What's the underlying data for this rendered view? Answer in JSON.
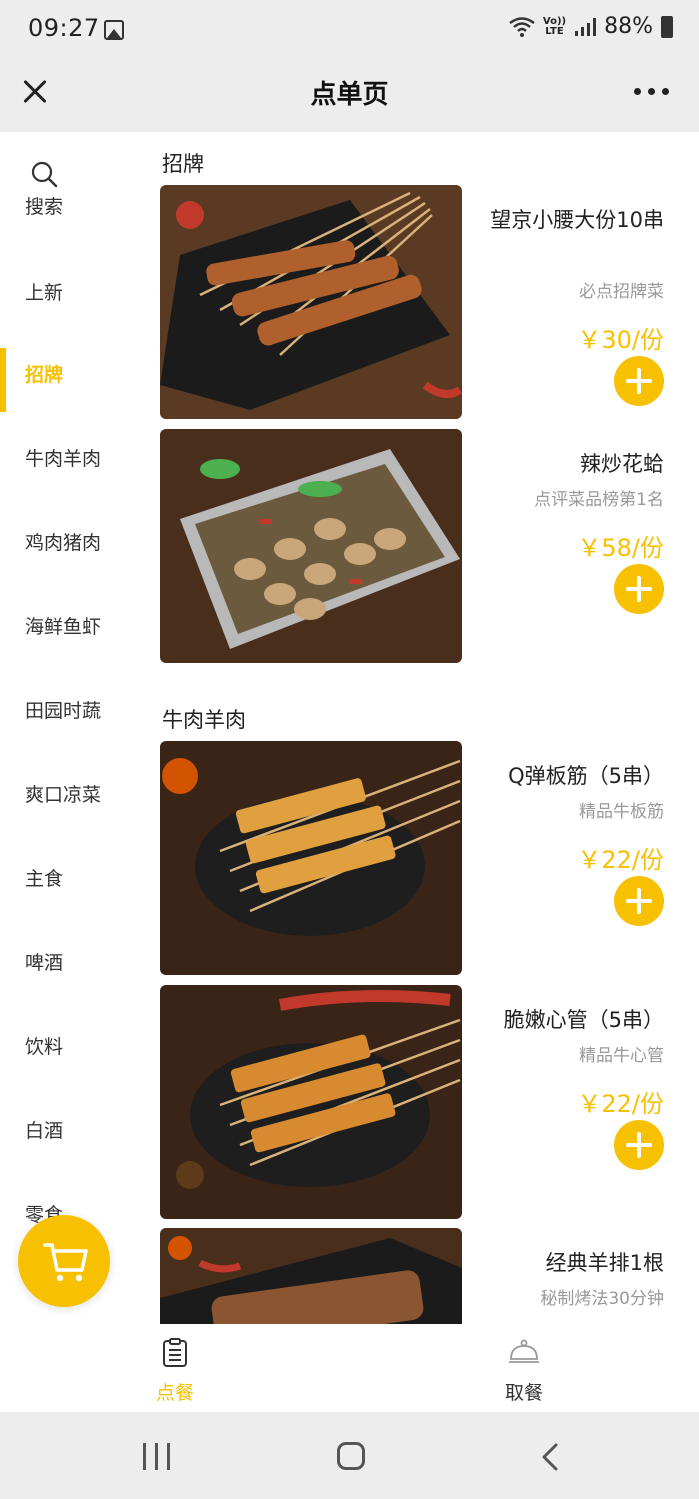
{
  "status_bar": {
    "time": "09:27",
    "battery": "88%",
    "volte": "Vo)) LTE"
  },
  "header": {
    "title": "点单页"
  },
  "sidebar": {
    "items": [
      {
        "label": "搜索",
        "icon": "search-icon"
      },
      {
        "label": "上新"
      },
      {
        "label": "招牌",
        "active": true
      },
      {
        "label": "牛肉羊肉"
      },
      {
        "label": "鸡肉猪肉"
      },
      {
        "label": "海鲜鱼虾"
      },
      {
        "label": "田园时蔬"
      },
      {
        "label": "爽口凉菜"
      },
      {
        "label": "主食"
      },
      {
        "label": "啤酒"
      },
      {
        "label": "饮料"
      },
      {
        "label": "白酒"
      },
      {
        "label": "零食"
      }
    ]
  },
  "sections": [
    {
      "title": "招牌",
      "dishes": [
        {
          "name": "望京小腰大份10串",
          "desc": "必点招牌菜",
          "price": "￥30/份"
        },
        {
          "name": "辣炒花蛤",
          "desc": "点评菜品榜第1名",
          "price": "￥58/份"
        }
      ]
    },
    {
      "title": "牛肉羊肉",
      "dishes": [
        {
          "name": "Q弹板筋（5串）",
          "desc": "精品牛板筋",
          "price": "￥22/份"
        },
        {
          "name": "脆嫩心管（5串）",
          "desc": "精品牛心管",
          "price": "￥22/份"
        },
        {
          "name": "经典羊排1根",
          "desc": "秘制烤法30分钟",
          "price": ""
        }
      ]
    }
  ],
  "tabs": [
    {
      "label": "点餐",
      "icon": "order-list-icon",
      "active": true
    },
    {
      "label": "取餐",
      "icon": "cloche-icon",
      "active": false
    }
  ],
  "colors": {
    "accent": "#f7c000",
    "header_bg": "#ededed",
    "desc_gray": "#999999"
  }
}
